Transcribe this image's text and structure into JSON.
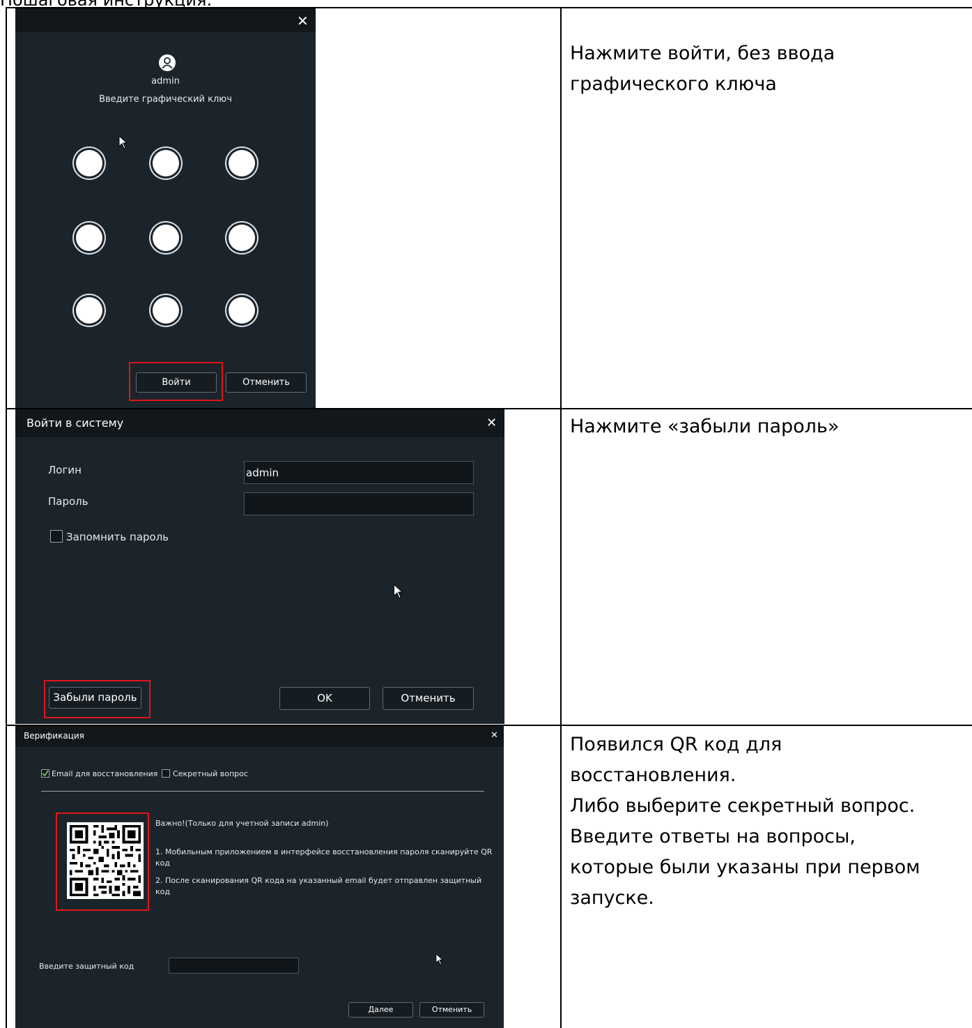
{
  "page_heading": "Пошаговая инструкция:",
  "rows": [
    {
      "description": [
        "Нажмите войти, без ввода",
        "графического ключа"
      ]
    },
    {
      "description": [
        "Нажмите «забыли пароль»"
      ]
    },
    {
      "description": [
        "Появился QR код для",
        "восстановления.",
        "Либо выберите секретный вопрос.",
        "Введите ответы на вопросы,",
        "которые были указаны при первом",
        "запуске."
      ]
    }
  ],
  "pattern_dialog": {
    "close_icon": "close-icon",
    "user_icon": "user-icon",
    "username": "admin",
    "prompt": "Введите графический ключ",
    "grid_size": 9,
    "login_button": "Войти",
    "cancel_button": "Отменить"
  },
  "login_dialog": {
    "title": "Войти в систему",
    "login_label": "Логин",
    "login_value": "admin",
    "password_label": "Пароль",
    "password_value": "",
    "remember_label": "Запомнить пароль",
    "remember_checked": false,
    "forgot_button": "Забыли пароль",
    "ok_button": "OK",
    "cancel_button": "Отменить"
  },
  "verify_dialog": {
    "title": "Верификация",
    "email_option": "Email для восстановления",
    "email_checked": true,
    "secret_option": "Секретный вопрос",
    "secret_checked": false,
    "important": "Важно!(Только для учетной записи admin)",
    "step1_a": "1. Мобильным приложением в интерфейсе восстановления пароля сканируйте QR",
    "step1_b": "код",
    "step2_a": "2. После сканирования QR кода на указанный email будет отправлен защитный",
    "step2_b": "код",
    "code_label": "Введите защитный код",
    "code_value": "",
    "next_button": "Далее",
    "cancel_button": "Отменить"
  },
  "colors": {
    "accent_highlight": "#e0141b",
    "dialog_bg": "#1b242b",
    "titlebar_bg": "#11171b"
  }
}
